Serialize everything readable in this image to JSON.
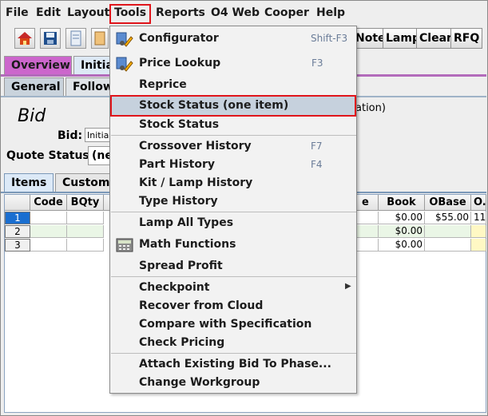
{
  "menubar": {
    "items": [
      "File",
      "Edit",
      "Layout",
      "Tools",
      "Reports",
      "O4 Web",
      "Cooper",
      "Help"
    ]
  },
  "toolbar": {
    "icons": [
      "home-icon",
      "save-icon",
      "document-icon",
      "clipboard-icon"
    ],
    "buttons": [
      "Note",
      "Lamp",
      "Clear",
      "RFQ"
    ]
  },
  "tabs": {
    "top": [
      "Overview",
      "Initia"
    ],
    "second": [
      "General",
      "Follow"
    ],
    "items_row": [
      "Items",
      "Custome"
    ]
  },
  "bid": {
    "title": "Bid",
    "bid_label": "Bid:",
    "bid_value": "Initia",
    "quote_status_label": "Quote Status:",
    "quote_status_value": "(ne",
    "partial_text": "ation)"
  },
  "grid": {
    "columns": [
      "Code",
      "BQty",
      "e",
      "Book",
      "OBase",
      "O."
    ],
    "rows": [
      {
        "num": "1",
        "book": "$0.00",
        "obase": "$55.00",
        "o": "11"
      },
      {
        "num": "2",
        "book": "$0.00",
        "obase": "",
        "o": ""
      },
      {
        "num": "3",
        "book": "$0.00",
        "obase": "",
        "o": ""
      }
    ]
  },
  "tools_menu": {
    "items": [
      {
        "label": "Configurator",
        "shortcut": "Shift-F3",
        "icon": "configurator-icon"
      },
      {
        "label": "Price Lookup",
        "shortcut": "F3",
        "icon": "price-lookup-icon"
      },
      {
        "label": "Reprice",
        "shortcut": ""
      },
      {
        "label": "Stock Status (one item)",
        "shortcut": ""
      },
      {
        "label": "Stock Status",
        "shortcut": ""
      },
      {
        "label": "Crossover History",
        "shortcut": "F7"
      },
      {
        "label": "Part History",
        "shortcut": "F4"
      },
      {
        "label": "Kit / Lamp History",
        "shortcut": ""
      },
      {
        "label": "Type History",
        "shortcut": ""
      },
      {
        "label": "Lamp All Types",
        "shortcut": ""
      },
      {
        "label": "Math Functions",
        "shortcut": "",
        "icon": "calculator-icon"
      },
      {
        "label": "Spread Profit",
        "shortcut": ""
      },
      {
        "label": "Checkpoint",
        "shortcut": "",
        "submenu": true
      },
      {
        "label": "Recover from Cloud",
        "shortcut": ""
      },
      {
        "label": "Compare with Specification",
        "shortcut": ""
      },
      {
        "label": "Check Pricing",
        "shortcut": ""
      },
      {
        "label": "Attach Existing Bid To Phase...",
        "shortcut": ""
      },
      {
        "label": "Change Workgroup",
        "shortcut": ""
      }
    ]
  },
  "colors": {
    "highlight_border": "#e0151b",
    "menu_highlight": "#c6d1dd",
    "overview_tab": "#cc66cc",
    "selected_row": "#1a6ed0"
  }
}
